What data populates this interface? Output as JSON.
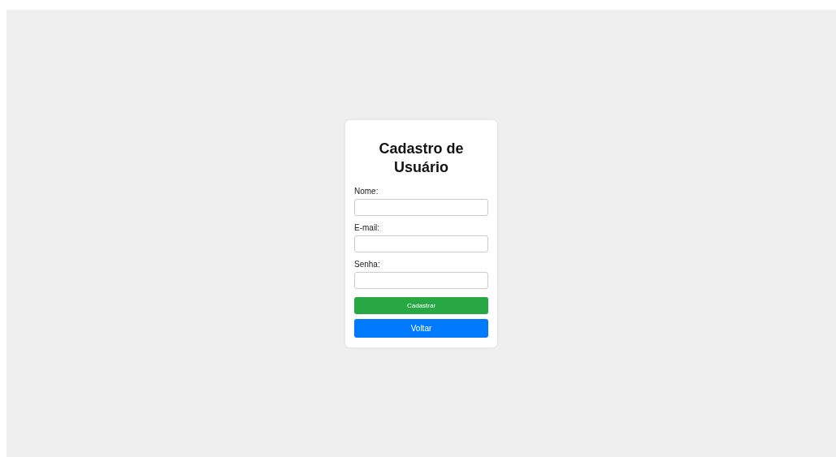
{
  "form": {
    "title": "Cadastro de Usuário",
    "fields": [
      {
        "label": "Nome:"
      },
      {
        "label": "E-mail:"
      },
      {
        "label": "Senha:"
      }
    ],
    "buttons": [
      {
        "label": "Cadastrar",
        "kind": "primary"
      },
      {
        "label": "Voltar",
        "kind": "secondary"
      }
    ]
  }
}
